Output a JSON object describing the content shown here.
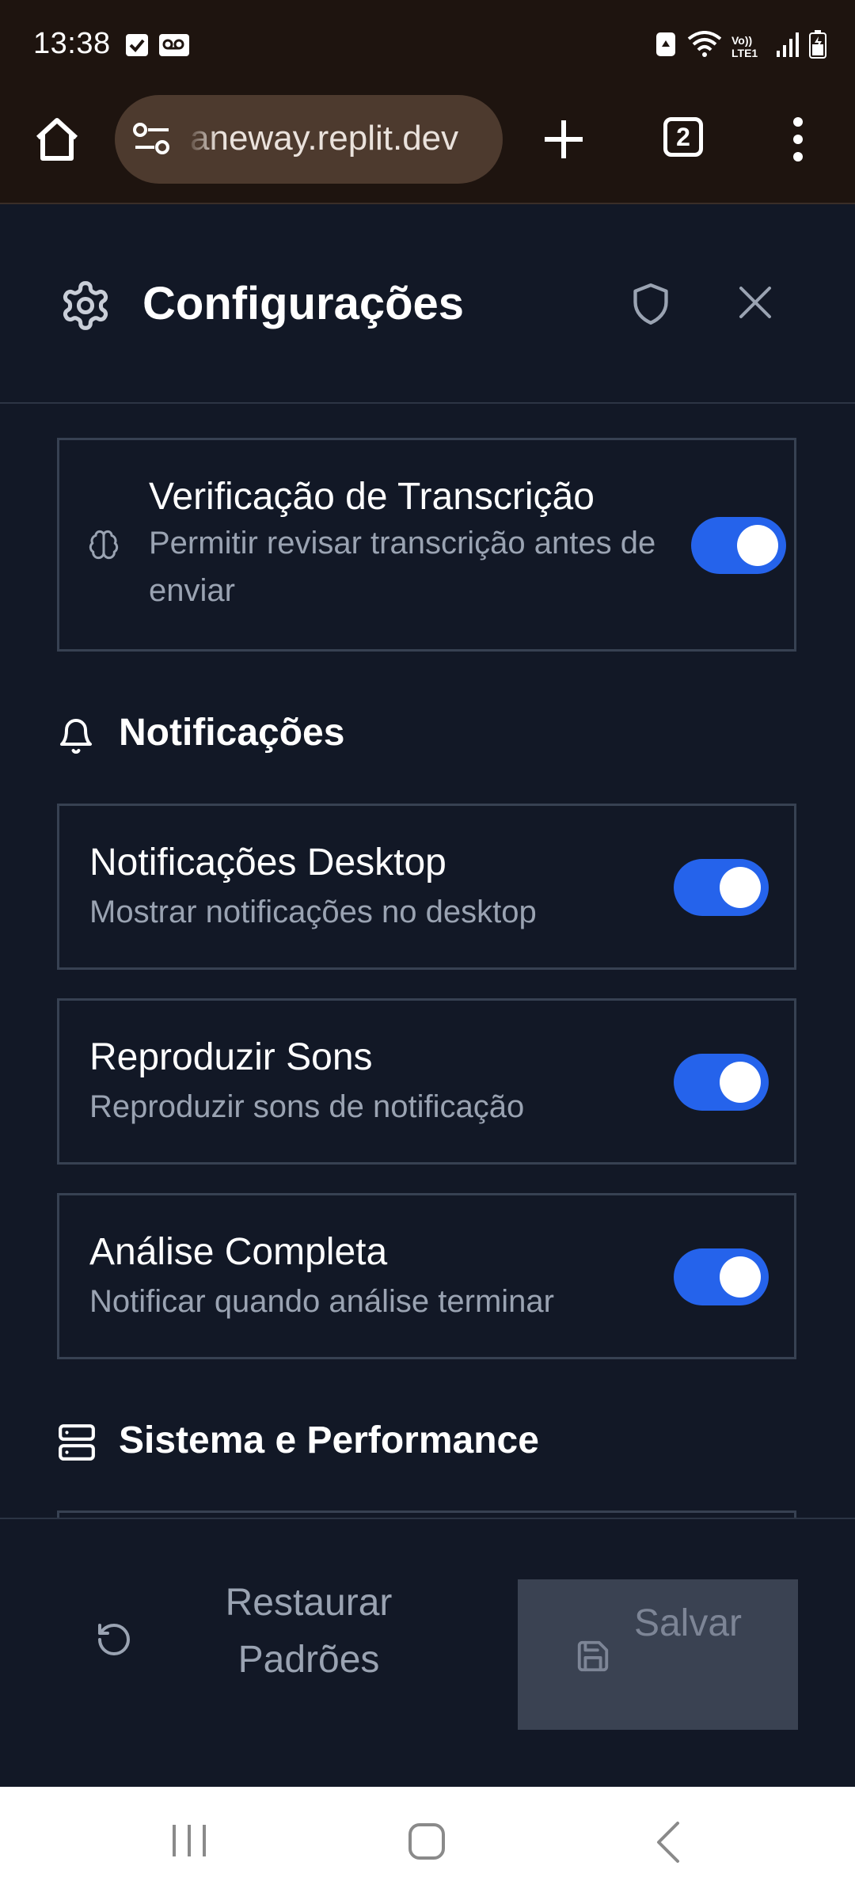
{
  "status_bar": {
    "time": "13:38",
    "left_icons": [
      "checkbox-notification-icon",
      "voicemail-icon"
    ],
    "right_icons": [
      "recycle-icon",
      "wifi-icon",
      "volte-icon",
      "signal-icon",
      "battery-icon"
    ],
    "volte_label": "Vo)) LTE1"
  },
  "browser": {
    "url": "aneway.replit.dev",
    "tab_count": "2"
  },
  "modal": {
    "title": "Configurações"
  },
  "settings": {
    "transcription": {
      "title": "Verificação de Transcrição",
      "description": "Permitir revisar transcrição antes de enviar",
      "enabled": true
    },
    "notifications_section": "Notificações",
    "notifications": [
      {
        "title": "Notificações Desktop",
        "description": "Mostrar notificações no desktop",
        "enabled": true
      },
      {
        "title": "Reproduzir Sons",
        "description": "Reproduzir sons de notificação",
        "enabled": true
      },
      {
        "title": "Análise Completa",
        "description": "Notificar quando análise terminar",
        "enabled": true
      }
    ],
    "system_section": "Sistema e Performance"
  },
  "footer": {
    "restore_label": "Restaurar Padrões",
    "save_label": "Salvar"
  },
  "colors": {
    "background": "#121826",
    "toggle_on": "#2563eb",
    "browser_chrome": "#1e140f"
  }
}
